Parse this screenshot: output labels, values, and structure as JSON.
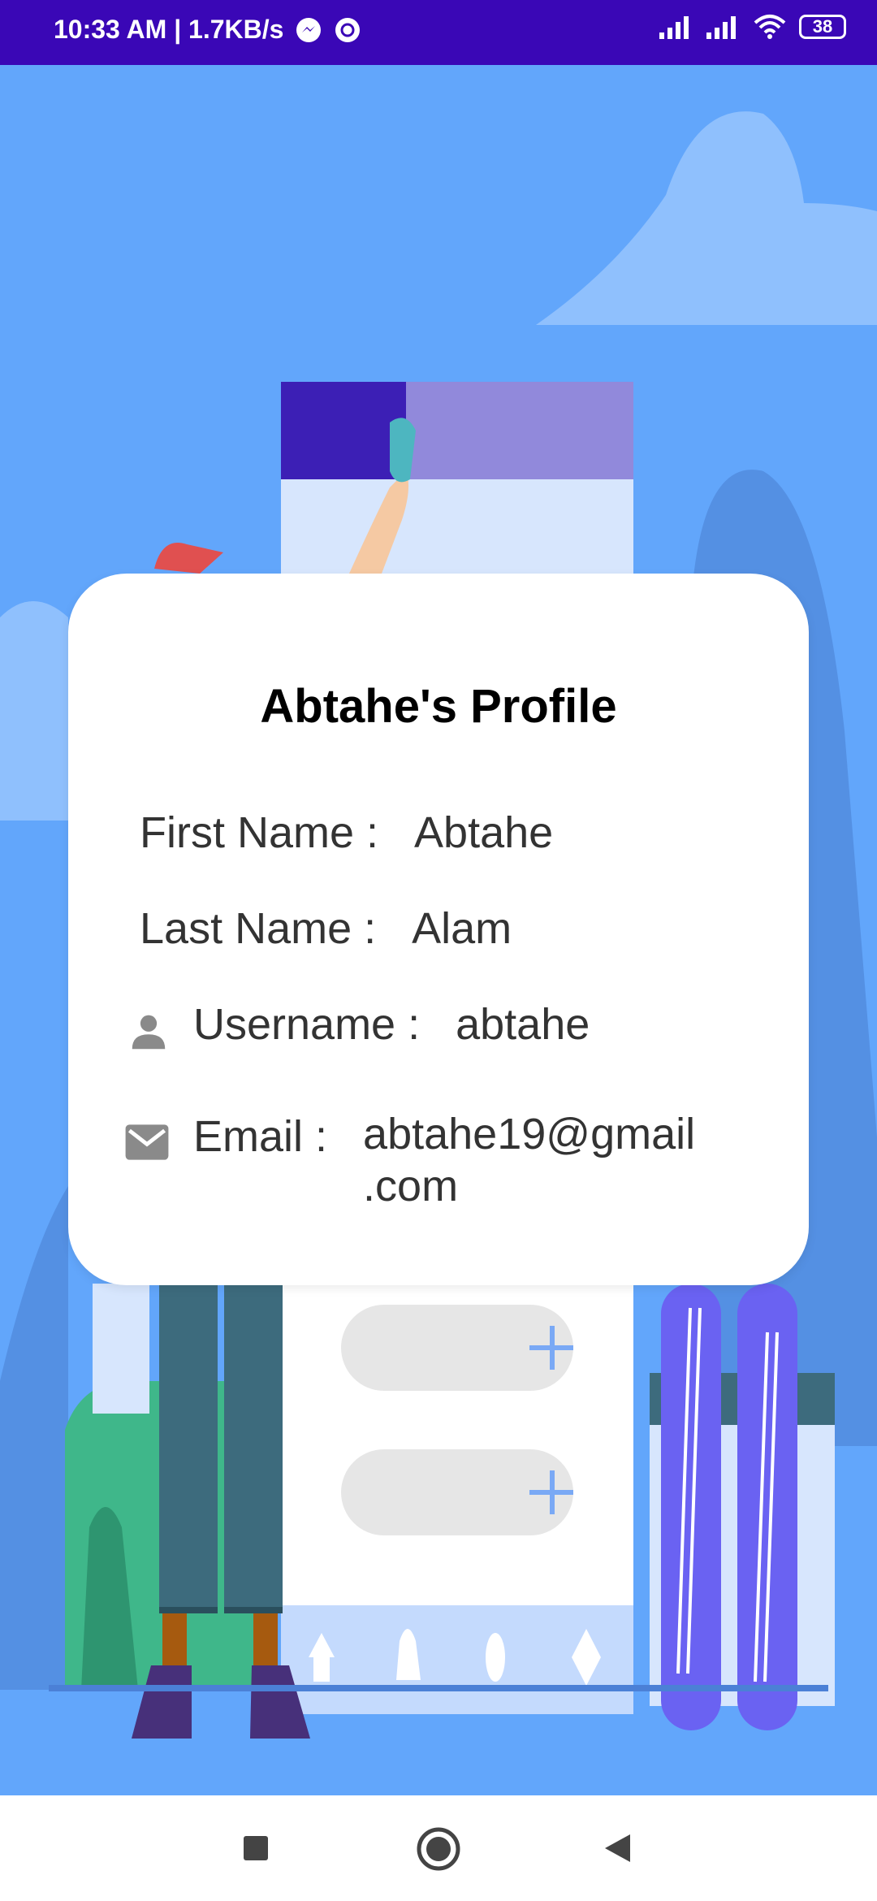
{
  "status_bar": {
    "time_and_speed": "10:33 AM | 1.7KB/s",
    "battery": "38"
  },
  "profile_card": {
    "title": "Abtahe's Profile",
    "first_name_label": "First Name :",
    "first_name_value": "Abtahe",
    "last_name_label": "Last Name :",
    "last_name_value": "Alam",
    "username_label": "Username :",
    "username_value": "abtahe",
    "email_label": "Email :",
    "email_value_line1": "abtahe19@gmail",
    "email_value_line2": ".com"
  },
  "icons": {
    "username": "person-icon",
    "email": "mail-icon",
    "nav_recent": "square-icon",
    "nav_home": "circle-icon",
    "nav_back": "triangle-back-icon"
  },
  "colors": {
    "status_bar": "#3a07b6",
    "background": "#62a6fb",
    "card": "#ffffff",
    "text": "#333333"
  }
}
